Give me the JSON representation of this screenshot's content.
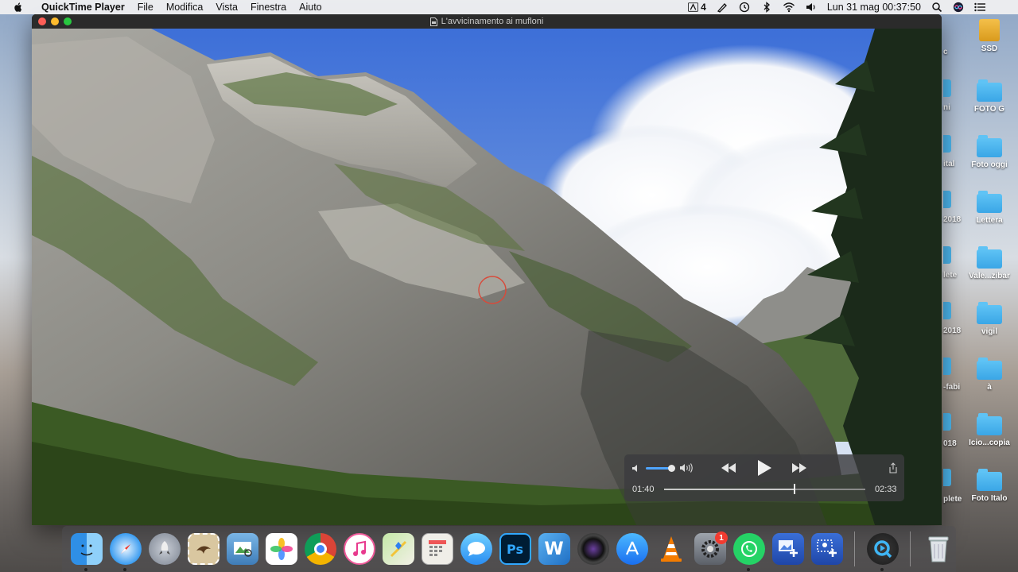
{
  "menubar": {
    "app_name": "QuickTime Player",
    "items": [
      "File",
      "Modifica",
      "Vista",
      "Finestra",
      "Aiuto"
    ],
    "ai_badge": "4",
    "clock": "Lun 31 mag  00:37:50"
  },
  "window": {
    "title": "L'avvicinamento ai mufloni"
  },
  "player": {
    "elapsed": "01:40",
    "total": "02:33",
    "volume": 0.8,
    "progress": 0.65
  },
  "desktop": {
    "icons": [
      {
        "label": "SSD",
        "kind": "drive"
      },
      {
        "label": "FOTO G",
        "kind": "folder"
      },
      {
        "label": "Foto oggi",
        "kind": "folder"
      },
      {
        "label": "Lettera",
        "kind": "folder"
      },
      {
        "label": "Vale...zibar",
        "kind": "folder"
      },
      {
        "label": "vigil",
        "kind": "folder"
      },
      {
        "label": "à",
        "kind": "folder"
      },
      {
        "label": "Icio...copia",
        "kind": "folder"
      },
      {
        "label": "Foto Italo",
        "kind": "folder"
      }
    ],
    "peek_labels": [
      "c",
      "ni",
      "ital",
      "2018",
      "lete",
      "2018",
      "-fabi",
      "018",
      "plete"
    ]
  },
  "dock": {
    "apps": [
      {
        "name": "finder",
        "running": true
      },
      {
        "name": "safari",
        "running": true
      },
      {
        "name": "launchpad",
        "running": false
      },
      {
        "name": "mail",
        "running": false
      },
      {
        "name": "preview",
        "running": false
      },
      {
        "name": "photos",
        "running": false
      },
      {
        "name": "chrome",
        "running": false
      },
      {
        "name": "itunes",
        "running": false
      },
      {
        "name": "maps",
        "running": false
      },
      {
        "name": "calculator",
        "running": false
      },
      {
        "name": "messages",
        "running": false
      },
      {
        "name": "photoshop",
        "running": false,
        "text": "Ps"
      },
      {
        "name": "word",
        "running": false,
        "text": "W"
      },
      {
        "name": "photo-booth",
        "running": false
      },
      {
        "name": "app-store",
        "running": false
      },
      {
        "name": "vlc",
        "running": false
      },
      {
        "name": "system-preferences",
        "running": false,
        "badge": "1"
      },
      {
        "name": "whatsapp",
        "running": true
      },
      {
        "name": "image-capture",
        "running": false
      },
      {
        "name": "screen-add",
        "running": false
      },
      {
        "name": "quicktime",
        "running": true
      },
      {
        "name": "trash",
        "running": false
      }
    ]
  },
  "colors": {
    "accent_volume": "#4fa5ff",
    "folder": "#3aa6e6"
  }
}
